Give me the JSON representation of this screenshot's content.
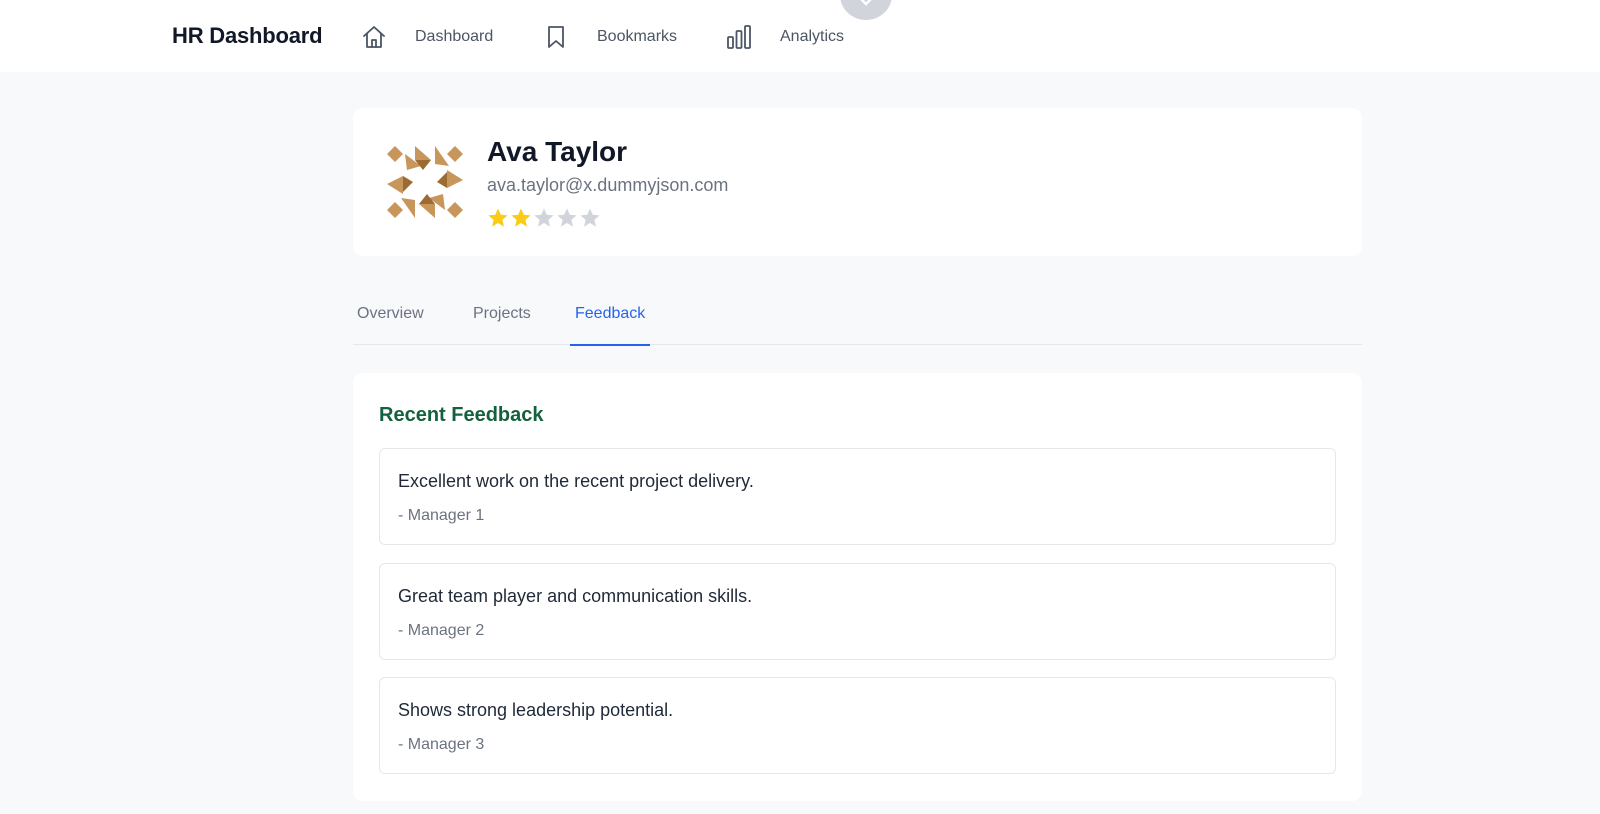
{
  "header": {
    "brand": "HR Dashboard",
    "nav": [
      {
        "label": "Dashboard",
        "icon": "home-icon"
      },
      {
        "label": "Bookmarks",
        "icon": "bookmark-icon"
      },
      {
        "label": "Analytics",
        "icon": "bar-chart-icon"
      }
    ]
  },
  "profile": {
    "name": "Ava Taylor",
    "email": "ava.taylor@x.dummyjson.com",
    "rating": 2,
    "rating_max": 5,
    "avatar_icon": "identicon-avatar",
    "star_filled_color": "#facc15",
    "star_empty_color": "#d1d5db"
  },
  "tabs": [
    {
      "label": "Overview",
      "active": false
    },
    {
      "label": "Projects",
      "active": false
    },
    {
      "label": "Feedback",
      "active": true
    }
  ],
  "feedback": {
    "title": "Recent Feedback",
    "items": [
      {
        "text": "Excellent work on the recent project delivery.",
        "author": "- Manager 1"
      },
      {
        "text": "Great team player and communication skills.",
        "author": "- Manager 2"
      },
      {
        "text": "Shows strong leadership potential.",
        "author": "- Manager 3"
      }
    ]
  },
  "colors": {
    "accent": "#2563eb",
    "section_title": "#14613f",
    "background": "#f8f9fb"
  }
}
